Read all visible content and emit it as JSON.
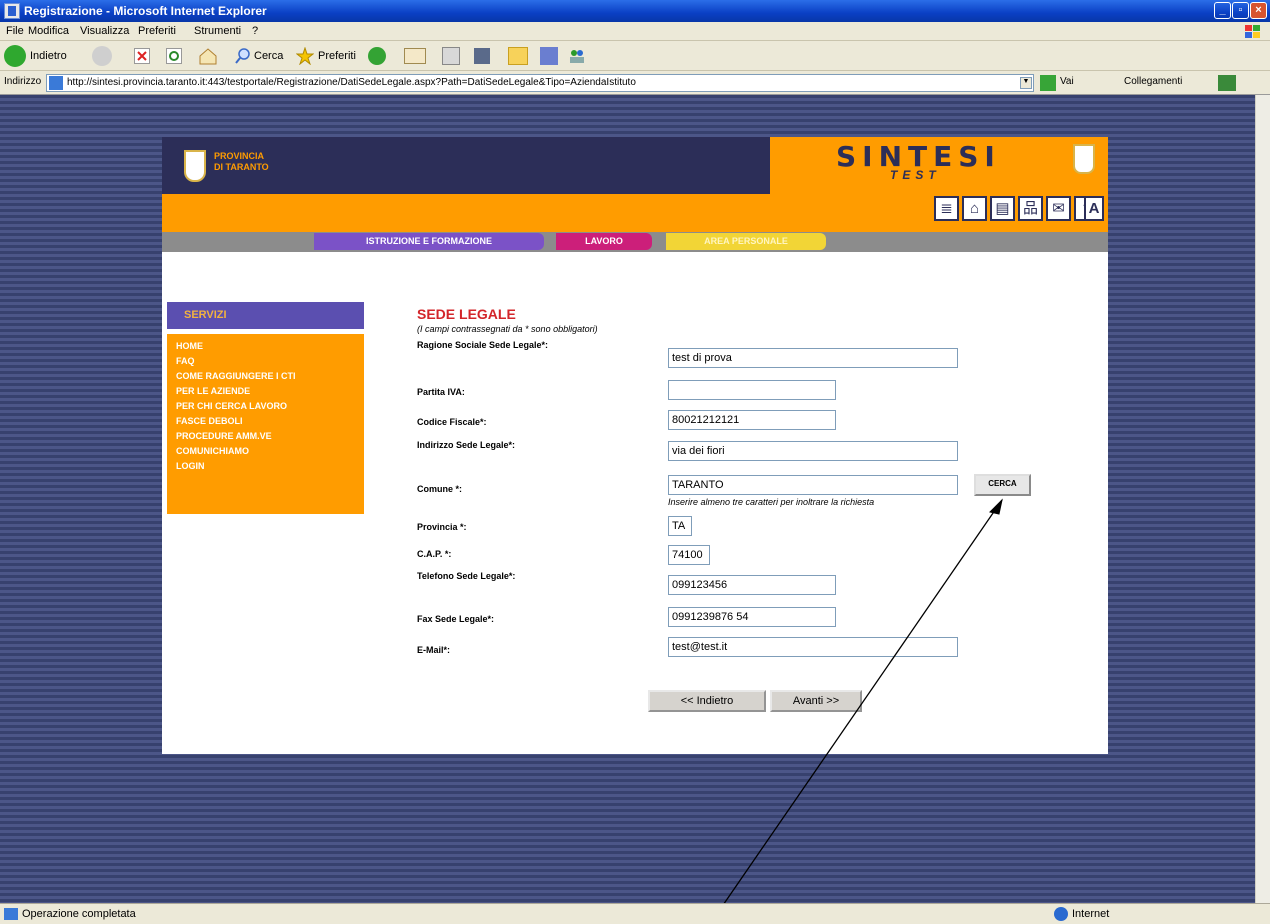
{
  "window": {
    "title": "Registrazione - Microsoft Internet Explorer",
    "controls": [
      "_",
      "▫",
      "×"
    ]
  },
  "menubar": {
    "items": [
      "File",
      "Modifica",
      "Visualizza",
      "Preferiti",
      "Strumenti",
      "?"
    ]
  },
  "toolbar": {
    "back_label": "Indietro",
    "search_label": "Cerca",
    "favorites_label": "Preferiti"
  },
  "addressbar": {
    "label": "Indirizzo",
    "url": "http://sintesi.provincia.taranto.it:443/testportale/Registrazione/DatiSedeLegale.aspx?Path=DatiSedeLegale&Tipo=AziendaIstituto",
    "go_label": "Vai",
    "links_label": "Collegamenti"
  },
  "site": {
    "brand_top": "PROVINCIA",
    "brand_bottom": "DI TARANTO",
    "logo_main": "SINTESI",
    "logo_sub": "TEST",
    "nav": [
      "ISTRUZIONE E FORMAZIONE",
      "LAVORO",
      "AREA PERSONALE"
    ],
    "sidebar_title": "SERVIZI",
    "sidebar_items": [
      "HOME",
      "FAQ",
      "COME RAGGIUNGERE I CTI",
      "PER LE AZIENDE",
      "PER CHI CERCA LAVORO",
      "FASCE DEBOLI",
      "PROCEDURE AMM.VE",
      "COMUNICHIAMO",
      "LOGIN"
    ]
  },
  "form": {
    "title": "SEDE LEGALE",
    "note": "(I campi contrassegnati da * sono obbligatori)",
    "fields": [
      {
        "label": "Ragione Sociale Sede Legale*:",
        "value": "test di prova"
      },
      {
        "label": "Partita IVA:",
        "value": ""
      },
      {
        "label": "Codice Fiscale*:",
        "value": "80021212121"
      },
      {
        "label": "Indirizzo Sede Legale*:",
        "value": "via dei fiori"
      },
      {
        "label": "Comune *:",
        "value": "TARANTO"
      },
      {
        "label": "Provincia *:",
        "value": "TA"
      },
      {
        "label": "C.A.P. *:",
        "value": "74100"
      },
      {
        "label": "Telefono Sede Legale*:",
        "value": "099123456"
      },
      {
        "label": "Fax Sede Legale*:",
        "value": "0991239876 54"
      },
      {
        "label": "E-Mail*:",
        "value": "test@test.it"
      }
    ],
    "search_button": "CERCA",
    "hint": "Inserire almeno tre caratteri per inoltrare la richiesta",
    "back_button": "<< Indietro",
    "next_button": "Avanti >>"
  },
  "statusbar": {
    "left": "Operazione completata",
    "zone": "Internet"
  }
}
